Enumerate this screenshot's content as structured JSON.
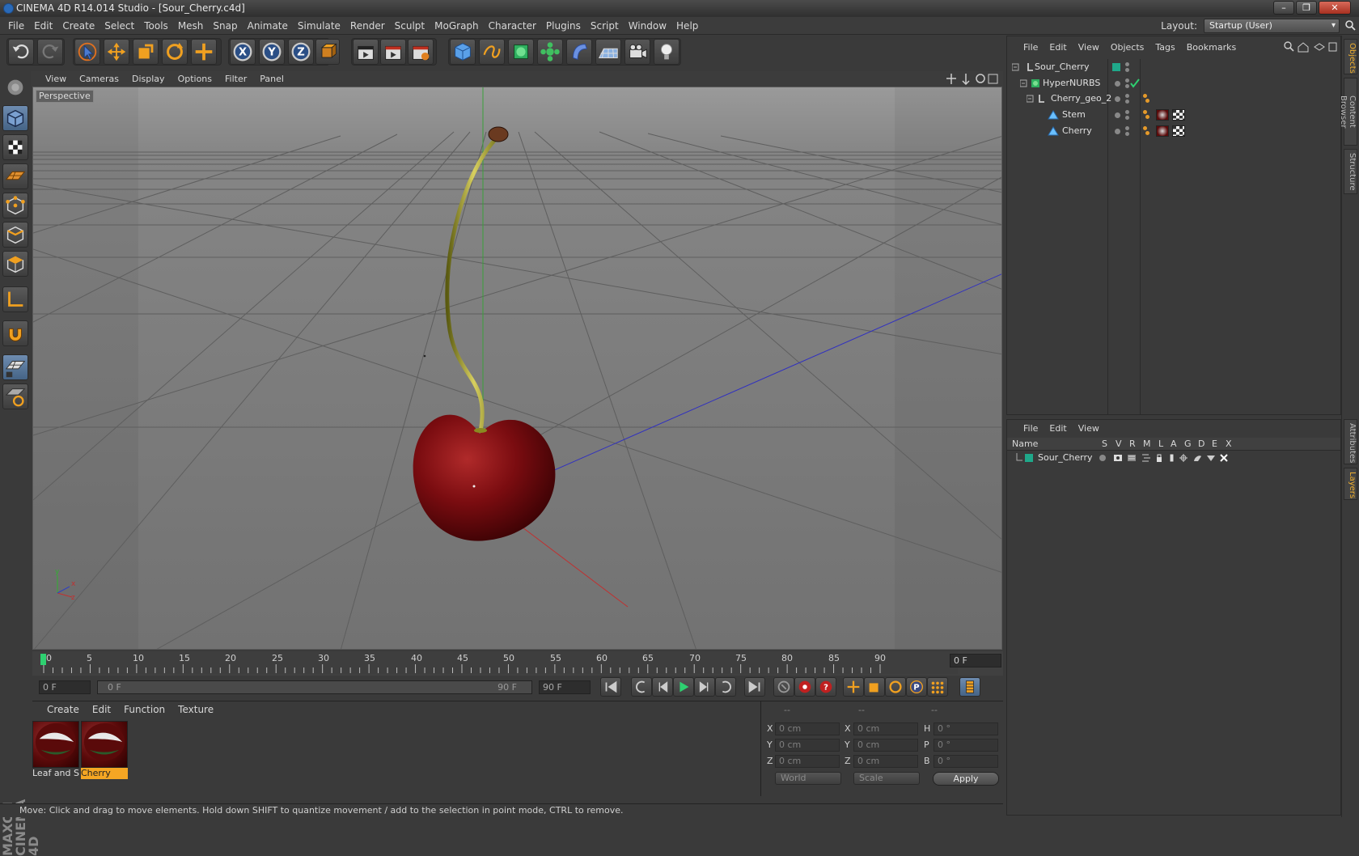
{
  "window": {
    "title": "CINEMA 4D R14.014 Studio - [Sour_Cherry.c4d]",
    "controls": [
      "minimize-icon",
      "restore-icon",
      "close-icon"
    ]
  },
  "menubar": {
    "items": [
      "File",
      "Edit",
      "Create",
      "Select",
      "Tools",
      "Mesh",
      "Snap",
      "Animate",
      "Simulate",
      "Render",
      "Sculpt",
      "MoGraph",
      "Character",
      "Plugins",
      "Script",
      "Window",
      "Help"
    ],
    "layout_label": "Layout:",
    "layout_value": "Startup (User)"
  },
  "viewport": {
    "menu": [
      "View",
      "Cameras",
      "Display",
      "Options",
      "Filter",
      "Panel"
    ],
    "label": "Perspective",
    "axis_labels": {
      "y": "y",
      "x": "x",
      "z": "z"
    }
  },
  "timeline": {
    "ticks": [
      "0",
      "5",
      "10",
      "15",
      "20",
      "25",
      "30",
      "35",
      "40",
      "45",
      "50",
      "55",
      "60",
      "65",
      "70",
      "75",
      "80",
      "85",
      "90"
    ],
    "current_frame_field": "0 F",
    "start_field": "0 F",
    "range_start": "0 F",
    "range_end": "90 F",
    "end_field": "90 F"
  },
  "materials": {
    "menu": [
      "Create",
      "Edit",
      "Function",
      "Texture"
    ],
    "items": [
      {
        "name": "Leaf and St",
        "selected": false
      },
      {
        "name": "Cherry",
        "selected": true
      }
    ]
  },
  "coordinates": {
    "headers": [
      "--",
      "--",
      "--"
    ],
    "rows": [
      {
        "axis": "X",
        "pos": "0 cm",
        "axis2": "X",
        "size": "0 cm",
        "rot_label": "H",
        "rot": "0 °"
      },
      {
        "axis": "Y",
        "pos": "0 cm",
        "axis2": "Y",
        "size": "0 cm",
        "rot_label": "P",
        "rot": "0 °"
      },
      {
        "axis": "Z",
        "pos": "0 cm",
        "axis2": "Z",
        "size": "0 cm",
        "rot_label": "B",
        "rot": "0 °"
      }
    ],
    "space_select": "World",
    "mode_select": "Scale",
    "apply_label": "Apply"
  },
  "object_manager": {
    "menu": [
      "File",
      "Edit",
      "View",
      "Objects",
      "Tags",
      "Bookmarks"
    ],
    "objects": [
      {
        "name": "Sour_Cherry",
        "depth": 0
      },
      {
        "name": "HyperNURBS",
        "depth": 1
      },
      {
        "name": "Cherry_geo_2",
        "depth": 1
      },
      {
        "name": "Stem",
        "depth": 2
      },
      {
        "name": "Cherry",
        "depth": 2
      }
    ]
  },
  "layer_manager": {
    "menu": [
      "File",
      "Edit",
      "View"
    ],
    "columns": [
      "Name",
      "S",
      "V",
      "R",
      "M",
      "L",
      "A",
      "G",
      "D",
      "E",
      "X"
    ],
    "layers": [
      {
        "name": "Sour_Cherry",
        "color": "#1fa88a"
      }
    ]
  },
  "right_tabs": [
    "Objects",
    "Content Browser",
    "Structure",
    "Attributes",
    "Layers"
  ],
  "status": "Move: Click and drag to move elements. Hold down SHIFT to quantize movement / add to the selection in point mode, CTRL to remove.",
  "brand": "MAXON CINEMA 4D",
  "colors": {
    "accent": "#f0b030",
    "selection": "#f5a623",
    "axis_x": "#c03030",
    "axis_y": "#30b030",
    "axis_z": "#3030c0"
  }
}
